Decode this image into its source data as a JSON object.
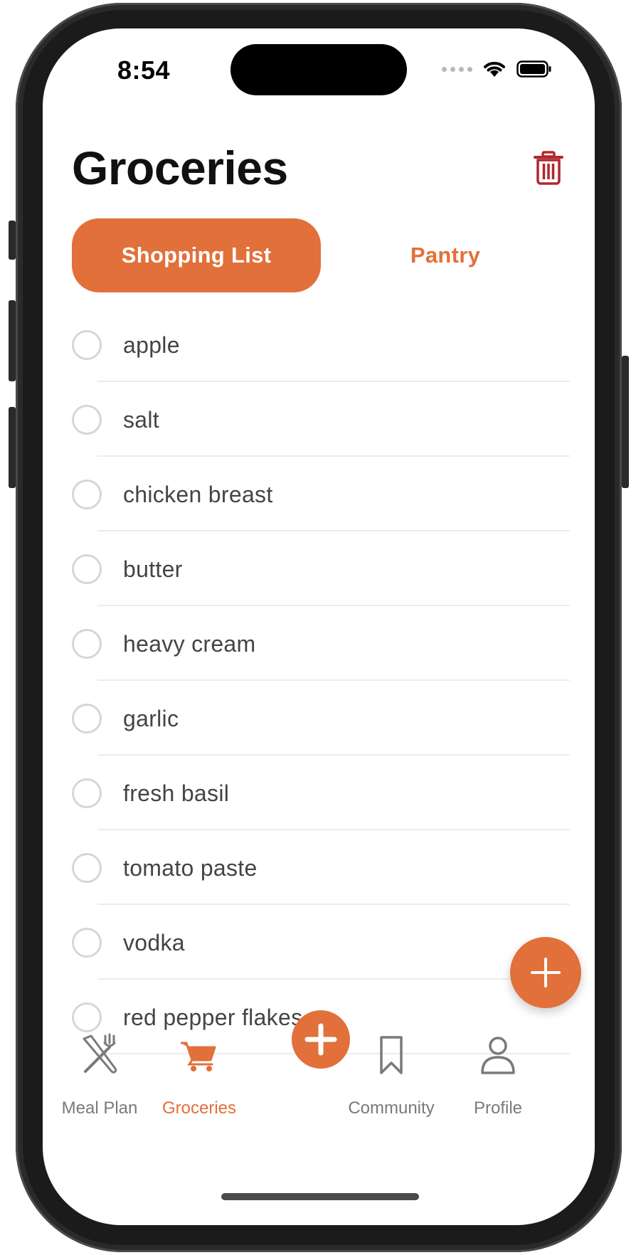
{
  "status_bar": {
    "time": "8:54"
  },
  "header": {
    "title": "Groceries"
  },
  "segments": {
    "active_label": "Shopping List",
    "inactive_label": "Pantry"
  },
  "shopping_list": {
    "items": [
      {
        "name": "apple"
      },
      {
        "name": "salt"
      },
      {
        "name": "chicken breast"
      },
      {
        "name": "butter"
      },
      {
        "name": "heavy cream"
      },
      {
        "name": "garlic"
      },
      {
        "name": "fresh basil"
      },
      {
        "name": "tomato paste"
      },
      {
        "name": "vodka"
      },
      {
        "name": "red pepper flakes"
      }
    ]
  },
  "tab_bar": {
    "meal_plan": "Meal Plan",
    "groceries": "Groceries",
    "community": "Community",
    "profile": "Profile",
    "active_tab": "Groceries"
  },
  "icons": {
    "trash": "trash-icon",
    "add_item": "plus-icon",
    "meal_plan": "fork-knife-icon",
    "groceries": "cart-icon",
    "community": "bookmark-icon",
    "profile": "person-icon"
  },
  "colors": {
    "accent": "#E2703A",
    "delete": "#B3262E",
    "text": "#111111",
    "muted": "#7a7a7a"
  }
}
